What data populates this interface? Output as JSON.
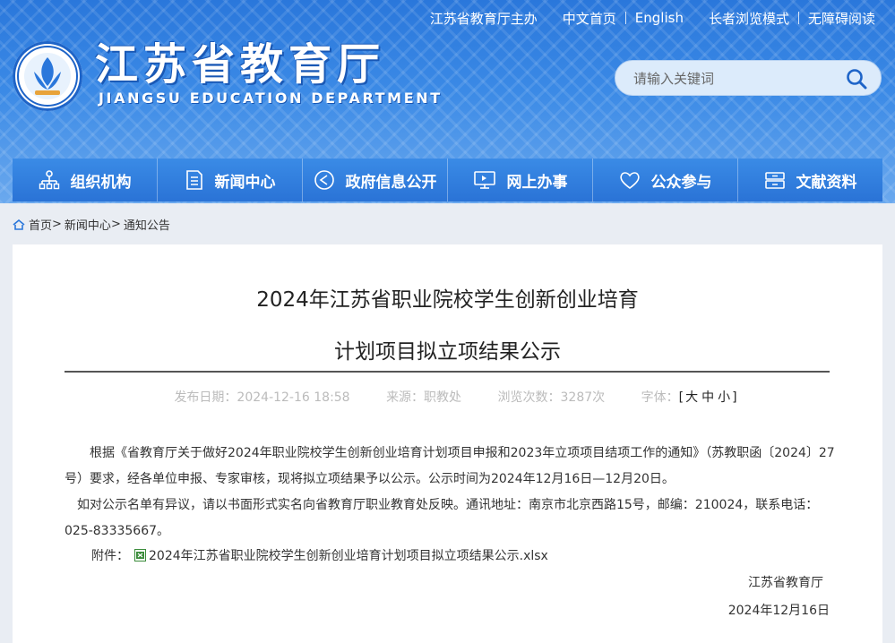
{
  "header": {
    "top_links": {
      "sponsor": "江苏省教育厅主办",
      "chinese_home": "中文首页",
      "english": "English",
      "elder_mode": "长者浏览模式",
      "accessibility": "无障碍阅读"
    },
    "logo_cn": "江苏省教育厅",
    "logo_en": "JIANGSU EDUCATION DEPARTMENT",
    "search_placeholder": "请输入关键词"
  },
  "nav": [
    {
      "label": "组织机构",
      "icon": "org-chart-icon"
    },
    {
      "label": "新闻中心",
      "icon": "news-icon"
    },
    {
      "label": "政府信息公开",
      "icon": "info-disclosure-icon"
    },
    {
      "label": "网上办事",
      "icon": "online-service-icon"
    },
    {
      "label": "公众参与",
      "icon": "heart-icon"
    },
    {
      "label": "文献资料",
      "icon": "documents-icon"
    }
  ],
  "breadcrumb": [
    "首页",
    "新闻中心",
    "通知公告"
  ],
  "breadcrumb_sep": ">",
  "article": {
    "title_line1": "2024年江苏省职业院校学生创新创业培育",
    "title_line2": "计划项目拟立项结果公示",
    "meta": {
      "date": "发布日期：2024-12-16 18:58",
      "source": "来源：职教处",
      "views": "浏览次数：3287次",
      "font_label": "字体：",
      "sizes": [
        "大",
        "中",
        "小"
      ]
    },
    "p1": "根据《省教育厅关于做好2024年职业院校学生创新创业培育计划项目申报和2023年立项项目结项工作的通知》（苏教职函〔2024〕27号）要求，经各单位申报、专家审核，现将拟立项结果予以公示。公示时间为2024年12月16日—12月20日。",
    "p2": "如对公示名单有异议，请以书面形式实名向省教育厅职业教育处反映。通讯地址：南京市北京西路15号，邮编：210024，联系电话：025-83335667。",
    "attachment_label": "附件：",
    "attachment_file": "2024年江苏省职业院校学生创新创业培育计划项目拟立项结果公示.xlsx",
    "signature": "江苏省教育厅",
    "sign_date": "2024年12月16日"
  }
}
